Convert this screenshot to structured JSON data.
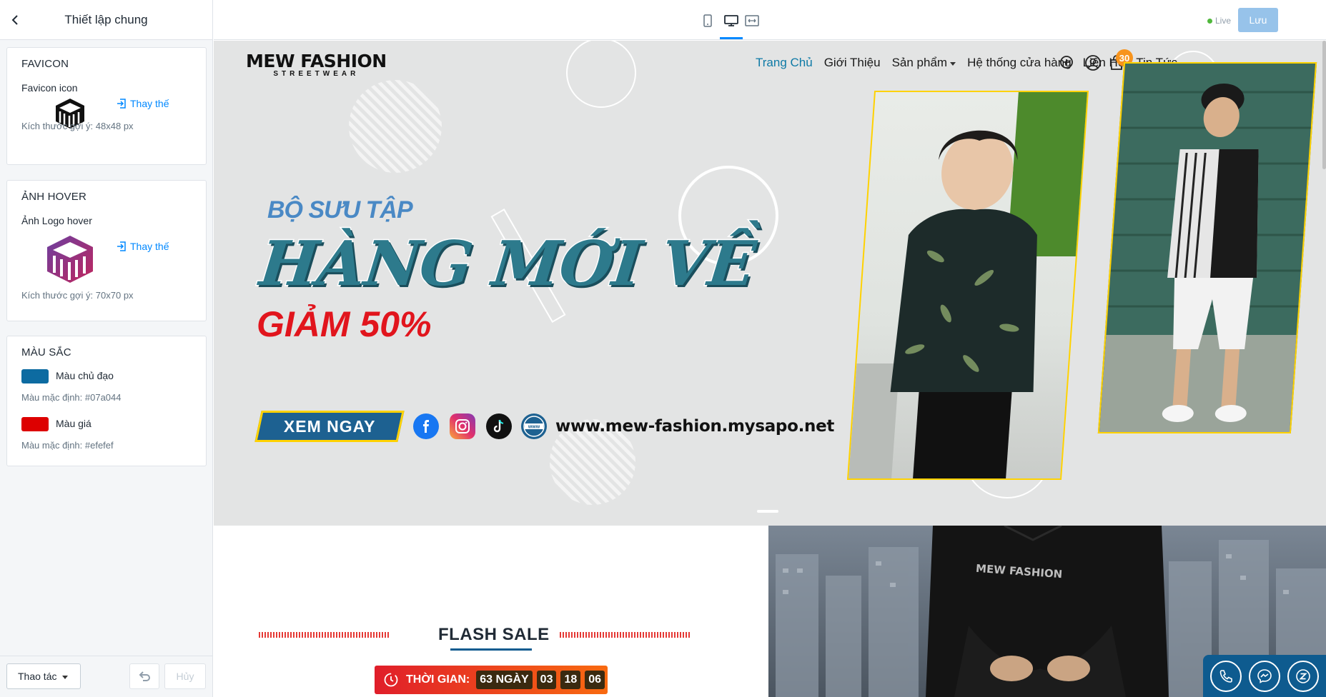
{
  "sidebar": {
    "title": "Thiết lập chung",
    "favicon": {
      "section_title": "FAVICON",
      "label": "Favicon icon",
      "replace": "Thay thế",
      "hint": "Kích thước gợi ý: 48x48 px"
    },
    "hover": {
      "section_title": "ẢNH HOVER",
      "label": "Ảnh Logo hover",
      "replace": "Thay thế",
      "hint": "Kích thước gợi ý: 70x70 px"
    },
    "colors": {
      "section_title": "MÀU SẮC",
      "items": [
        {
          "label": "Màu chủ đạo",
          "swatch": "#07a044",
          "display_color": "#0d6ba1",
          "hint": "Màu mặc định: #07a044"
        },
        {
          "label": "Màu giá",
          "swatch": "#efefef",
          "display_color": "#dd0000",
          "hint": "Màu mặc định: #efefef"
        }
      ]
    },
    "footer": {
      "action": "Thao tác",
      "cancel": "Hủy"
    }
  },
  "topbar": {
    "devices": [
      "mobile-icon",
      "desktop-icon",
      "fullwidth-icon"
    ],
    "status": "Live",
    "save": "Lưu"
  },
  "preview": {
    "logo": {
      "main": "MEW FASHION",
      "sub": "STREETWEAR"
    },
    "nav": [
      "Trang Chủ",
      "Giới Thiệu",
      "Sản phẩm",
      "Hệ thống cửa hàng",
      "Liên Hệ",
      "Tin Tức"
    ],
    "cart_count": "30",
    "hero": {
      "subtitle": "BỘ SƯU TẬP",
      "title": "HÀNG MỚI VỀ",
      "discount": "GIẢM 50%",
      "cta": "XEM NGAY",
      "website": "www.mew-fashion.mysapo.net",
      "socials": [
        "facebook-icon",
        "instagram-icon",
        "tiktok-icon",
        "www-icon"
      ]
    },
    "flash_sale": {
      "title": "FLASH SALE",
      "timer_label": "THỜI GIAN:",
      "days": "63 NGÀY",
      "hours": "03",
      "minutes": "18",
      "seconds": "06"
    },
    "banner2_text": "MEW FASHION",
    "contact": [
      "phone-icon",
      "messenger-icon",
      "zalo-icon"
    ]
  },
  "colors": {
    "accent": "#0088ff",
    "brand": "#0e5b8f",
    "primary_nav": "#0e7aa6"
  }
}
